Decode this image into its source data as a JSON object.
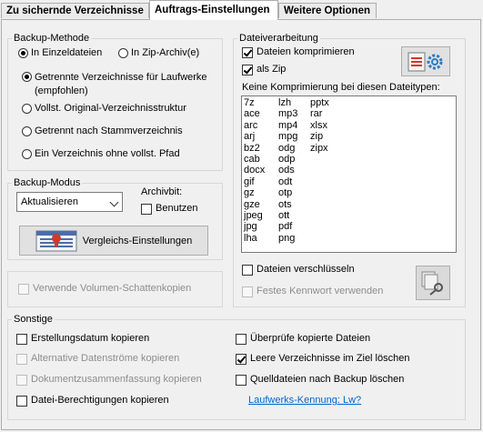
{
  "tabs": [
    {
      "label": "Zu sichernde Verzeichnisse"
    },
    {
      "label": "Auftrags-Einstellungen"
    },
    {
      "label": "Weitere Optionen"
    }
  ],
  "backup_method": {
    "title": "Backup-Methode",
    "single_files": "In Einzeldateien",
    "zip_archive": "In Zip-Archiv(e)",
    "opt1_line1": "Getrennte Verzeichnisse für Laufwerke",
    "opt1_line2": "(empfohlen)",
    "opt2": "Vollst. Original-Verzeichnisstruktur",
    "opt3": "Getrennt nach Stammverzeichnis",
    "opt4": "Ein Verzeichnis ohne vollst. Pfad"
  },
  "backup_mode": {
    "title": "Backup-Modus",
    "selected": "Aktualisieren",
    "archive_bit_label": "Archivbit:",
    "use_label": "Benutzen",
    "compare_button": "Vergleichs-Einstellungen"
  },
  "shadow_copy_label": "Verwende Volumen-Schattenkopien",
  "file_processing": {
    "title": "Dateiverarbeitung",
    "compress_label": "Dateien komprimieren",
    "as_zip_label": "als Zip",
    "no_compress_label": "Keine Komprimierung bei diesen Dateitypen:",
    "columns": [
      [
        "7z",
        "ace",
        "arc",
        "arj",
        "bz2",
        "cab",
        "docx",
        "gif",
        "gz",
        "gze",
        "jpeg",
        "jpg",
        "lha"
      ],
      [
        "lzh",
        "mp3",
        "mp4",
        "mpg",
        "odg",
        "odp",
        "ods",
        "odt",
        "otp",
        "ots",
        "ott",
        "pdf",
        "png"
      ],
      [
        "pptx",
        "rar",
        "xlsx",
        "zip",
        "zipx"
      ]
    ],
    "encrypt_label": "Dateien verschlüsseln",
    "fixed_password_label": "Festes Kennwort verwenden"
  },
  "misc": {
    "title": "Sonstige",
    "creation_date": "Erstellungsdatum kopieren",
    "alt_streams": "Alternative Datenströme kopieren",
    "doc_summary": "Dokumentzusammenfassung kopieren",
    "permissions": "Datei-Berechtigungen kopieren",
    "verify": "Überprüfe kopierte Dateien",
    "delete_empty": "Leere Verzeichnisse im Ziel löschen",
    "delete_source": "Quelldateien nach Backup löschen",
    "drive_id_link": "Laufwerks-Kennung: Lw?"
  }
}
